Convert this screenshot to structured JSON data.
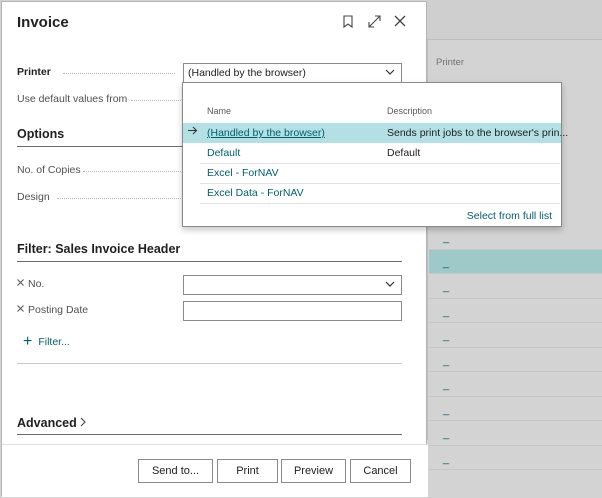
{
  "background": {
    "column_header": "Printer",
    "rows": [
      "_",
      "_",
      "_",
      "_",
      "_",
      "_",
      "_",
      "_",
      "_",
      "_"
    ],
    "selected_row_index": 1
  },
  "dialog": {
    "title": "Invoice",
    "printer_label": "Printer",
    "printer_value": "(Handled by the browser)",
    "default_values_label": "Use default values from",
    "options_title": "Options",
    "copies_label": "No. of Copies",
    "design_label": "Design",
    "filter_title": "Filter: Sales Invoice Header",
    "filters": [
      {
        "label": "No.",
        "value": ""
      },
      {
        "label": "Posting Date",
        "value": ""
      }
    ],
    "add_filter_label": "Filter...",
    "advanced_label": "Advanced",
    "buttons": {
      "send_to": "Send to...",
      "print": "Print",
      "preview": "Preview",
      "cancel": "Cancel"
    }
  },
  "dropdown": {
    "col_name": "Name",
    "col_description": "Description",
    "items": [
      {
        "name": "(Handled by the browser)",
        "description": "Sends print jobs to the browser's prin...",
        "selected": true
      },
      {
        "name": "Default",
        "description": "Default",
        "selected": false
      },
      {
        "name": "Excel - ForNAV",
        "description": "",
        "selected": false
      },
      {
        "name": "Excel Data - ForNAV",
        "description": "",
        "selected": false
      }
    ],
    "select_full_list": "Select from full list"
  },
  "colors": {
    "accent": "#00606b",
    "selected_row": "#b3e0e5",
    "background_selected_row": "#9fc9c9"
  },
  "icons": [
    "bookmark-icon",
    "expand-icon",
    "close-icon",
    "chevron-down-icon",
    "arrow-right-icon",
    "remove-filter-icon",
    "plus-icon",
    "chevron-right-icon"
  ]
}
